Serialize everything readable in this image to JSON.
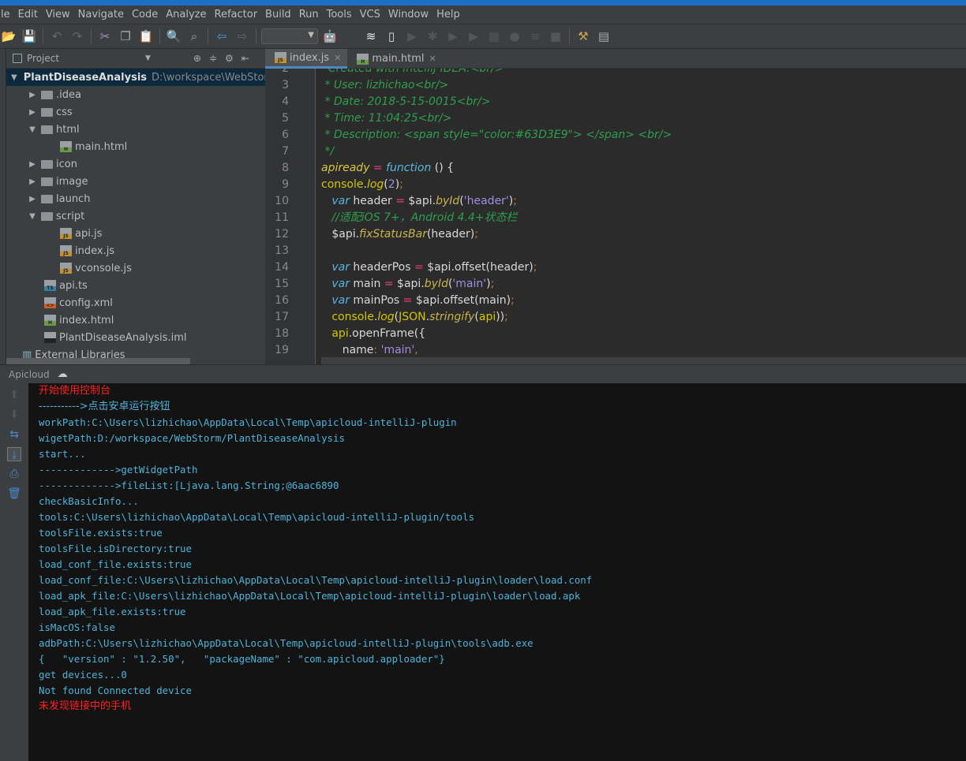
{
  "menu": [
    "le",
    "Edit",
    "View",
    "Navigate",
    "Code",
    "Analyze",
    "Refactor",
    "Build",
    "Run",
    "Tools",
    "VCS",
    "Window",
    "Help"
  ],
  "toolbar": {
    "icons": [
      "open-icon",
      "save-icon",
      "undo-icon",
      "redo-icon",
      "cut-icon",
      "copy-icon",
      "paste-icon",
      "find-icon",
      "replace-icon",
      "back-icon",
      "forward-icon"
    ],
    "run_config": "",
    "icons2": [
      "android-icon",
      "apple-icon",
      "wifi-icon",
      "device-icon",
      "run-icon",
      "debug-icon",
      "run-coverage-icon",
      "profile-icon",
      "attach-icon",
      "record-icon",
      "build-icon",
      "stop-icon",
      "project-structure-icon",
      "sdk-manager-icon"
    ]
  },
  "project_panel": {
    "title": "Project",
    "tree": [
      {
        "label": "PlantDiseaseAnalysis",
        "path": "D:\\workspace\\WebStorm",
        "type": "root",
        "depth": 0,
        "expanded": true
      },
      {
        "label": ".idea",
        "type": "folder",
        "depth": 1,
        "expanded": false
      },
      {
        "label": "css",
        "type": "folder",
        "depth": 1,
        "expanded": false
      },
      {
        "label": "html",
        "type": "folder",
        "depth": 1,
        "expanded": true
      },
      {
        "label": "main.html",
        "type": "html",
        "depth": 2
      },
      {
        "label": "icon",
        "type": "folder",
        "depth": 1,
        "expanded": false
      },
      {
        "label": "image",
        "type": "folder",
        "depth": 1,
        "expanded": false
      },
      {
        "label": "launch",
        "type": "folder",
        "depth": 1,
        "expanded": false
      },
      {
        "label": "script",
        "type": "folder",
        "depth": 1,
        "expanded": true
      },
      {
        "label": "api.js",
        "type": "js",
        "depth": 2
      },
      {
        "label": "index.js",
        "type": "js",
        "depth": 2
      },
      {
        "label": "vconsole.js",
        "type": "js",
        "depth": 2
      },
      {
        "label": "api.ts",
        "type": "ts",
        "depth": 1
      },
      {
        "label": "config.xml",
        "type": "xml",
        "depth": 1
      },
      {
        "label": "index.html",
        "type": "html",
        "depth": 1
      },
      {
        "label": "PlantDiseaseAnalysis.iml",
        "type": "iml",
        "depth": 1
      },
      {
        "label": "External Libraries",
        "type": "lib",
        "depth": 0
      }
    ]
  },
  "editor": {
    "tabs": [
      {
        "label": "index.js",
        "type": "js",
        "active": true
      },
      {
        "label": "main.html",
        "type": "html",
        "active": false
      }
    ],
    "lines": [
      {
        "n": "2",
        "t": [
          [
            "comment",
            "  Created with IntelliJ IDEA.<br/>"
          ]
        ]
      },
      {
        "n": "3",
        "t": [
          [
            "comment",
            " * User: lizhichao<br/>"
          ]
        ]
      },
      {
        "n": "4",
        "t": [
          [
            "comment",
            " * Date: 2018-5-15-0015<br/>"
          ]
        ]
      },
      {
        "n": "5",
        "t": [
          [
            "comment",
            " * Time: 11:04:25<br/>"
          ]
        ]
      },
      {
        "n": "6",
        "t": [
          [
            "comment",
            " * Description: <span style=\"color:#63D3E9\"> </span> <br/>"
          ]
        ]
      },
      {
        "n": "7",
        "t": [
          [
            "comment",
            " */"
          ]
        ]
      },
      {
        "n": "8",
        "t": [
          [
            "fn",
            "apiready"
          ],
          [
            "op",
            " = "
          ],
          [
            "kw",
            "function"
          ],
          [
            "punc",
            " () {"
          ]
        ]
      },
      {
        "n": "9",
        "t": [
          [
            "glob",
            "console"
          ],
          [
            "punc",
            "."
          ],
          [
            "method",
            "log"
          ],
          [
            "punc",
            "("
          ],
          [
            "num",
            "2"
          ],
          [
            "punc",
            ")"
          ],
          [
            "semi",
            ";"
          ]
        ]
      },
      {
        "n": "10",
        "t": [
          [
            "kw",
            "   var "
          ],
          [
            "id",
            "header "
          ],
          [
            "op",
            "= "
          ],
          [
            "id",
            "$api."
          ],
          [
            "mi",
            "byId"
          ],
          [
            "punc",
            "("
          ],
          [
            "str",
            "'header'"
          ],
          [
            "punc",
            ")"
          ],
          [
            "semi",
            ";"
          ]
        ]
      },
      {
        "n": "11",
        "t": [
          [
            "comment",
            "   //适配iOS 7+，Android 4.4+状态栏"
          ]
        ]
      },
      {
        "n": "12",
        "t": [
          [
            "id",
            "   $api."
          ],
          [
            "mi",
            "fixStatusBar"
          ],
          [
            "punc",
            "(header)"
          ],
          [
            "semi",
            ";"
          ]
        ]
      },
      {
        "n": "13",
        "t": []
      },
      {
        "n": "14",
        "t": [
          [
            "kw",
            "   var "
          ],
          [
            "id",
            "headerPos "
          ],
          [
            "op",
            "= "
          ],
          [
            "id",
            "$api.offset(header)"
          ],
          [
            "semi",
            ";"
          ]
        ]
      },
      {
        "n": "15",
        "t": [
          [
            "kw",
            "   var "
          ],
          [
            "id",
            "main "
          ],
          [
            "op",
            "= "
          ],
          [
            "id",
            "$api."
          ],
          [
            "mi",
            "byId"
          ],
          [
            "punc",
            "("
          ],
          [
            "str",
            "'main'"
          ],
          [
            "punc",
            ")"
          ],
          [
            "semi",
            ";"
          ]
        ]
      },
      {
        "n": "16",
        "t": [
          [
            "kw",
            "   var "
          ],
          [
            "id",
            "mainPos "
          ],
          [
            "op",
            "= "
          ],
          [
            "id",
            "$api.offset(main)"
          ],
          [
            "semi",
            ";"
          ]
        ]
      },
      {
        "n": "17",
        "t": [
          [
            "glob",
            "   console"
          ],
          [
            "punc",
            "."
          ],
          [
            "method",
            "log"
          ],
          [
            "punc",
            "("
          ],
          [
            "glob",
            "JSON"
          ],
          [
            "punc",
            "."
          ],
          [
            "mi",
            "stringify"
          ],
          [
            "punc",
            "("
          ],
          [
            "glob",
            "api"
          ],
          [
            "punc",
            "))"
          ],
          [
            "semi",
            ";"
          ]
        ]
      },
      {
        "n": "18",
        "t": [
          [
            "glob",
            "   api"
          ],
          [
            "id",
            ".openFrame({"
          ]
        ]
      },
      {
        "n": "19",
        "t": [
          [
            "id",
            "      name"
          ],
          [
            "semi",
            ": "
          ],
          [
            "str",
            "'main'"
          ],
          [
            "semi",
            ","
          ]
        ]
      }
    ]
  },
  "tool_window": {
    "title": "Apicloud"
  },
  "console": {
    "lines": [
      {
        "text": "开始使用控制台",
        "color": "red"
      },
      {
        "text": "----------->点击安卓运行按钮",
        "color": "cn"
      },
      {
        "text": "workPath:C:\\Users\\lizhichao\\AppData\\Local\\Temp\\apicloud-intelliJ-plugin"
      },
      {
        "text": "wigetPath:D:/workspace/WebStorm/PlantDiseaseAnalysis"
      },
      {
        "text": "start..."
      },
      {
        "text": "------------->getWidgetPath"
      },
      {
        "text": "------------->fileList:[Ljava.lang.String;@6aac6890"
      },
      {
        "text": "checkBasicInfo..."
      },
      {
        "text": "tools:C:\\Users\\lizhichao\\AppData\\Local\\Temp\\apicloud-intelliJ-plugin/tools"
      },
      {
        "text": "toolsFile.exists:true"
      },
      {
        "text": "toolsFile.isDirectory:true"
      },
      {
        "text": "load_conf_file.exists:true"
      },
      {
        "text": "load_conf_file:C:\\Users\\lizhichao\\AppData\\Local\\Temp\\apicloud-intelliJ-plugin\\loader\\load.conf"
      },
      {
        "text": "load_apk_file:C:\\Users\\lizhichao\\AppData\\Local\\Temp\\apicloud-intelliJ-plugin\\loader\\load.apk"
      },
      {
        "text": "load_apk_file.exists:true"
      },
      {
        "text": "isMacOS:false"
      },
      {
        "text": "adbPath:C:\\Users\\lizhichao\\AppData\\Local\\Temp\\apicloud-intelliJ-plugin\\tools\\adb.exe"
      },
      {
        "text": "{   \"version\" : \"1.2.50\",   \"packageName\" : \"com.apicloud.apploader\"}"
      },
      {
        "text": "get devices...0"
      },
      {
        "text": "Not found Connected device"
      },
      {
        "text": "未发现链接中的手机",
        "color": "red"
      }
    ],
    "side_icons": [
      "up-icon",
      "down-icon",
      "soft-wrap-icon",
      "scroll-to-end-icon",
      "print-icon",
      "trash-icon"
    ]
  },
  "colors": {
    "accent": "#4a88c7",
    "title_bar": "#1d6fc5",
    "console_text": "#4fb3d9",
    "console_error": "#ff2020",
    "comment": "#2e9e4e"
  }
}
